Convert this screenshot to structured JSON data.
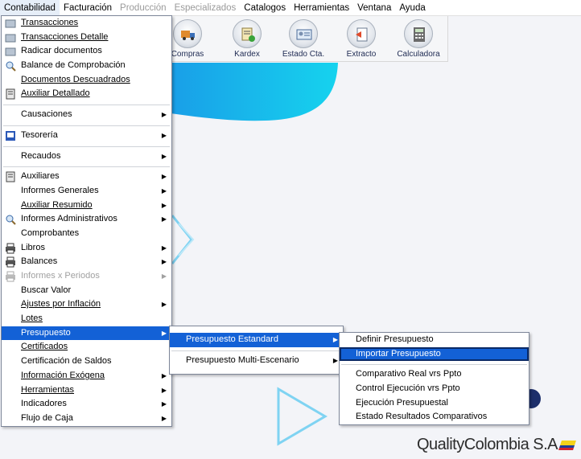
{
  "menubar": {
    "items": [
      {
        "label": "Contabilidad",
        "state": "active"
      },
      {
        "label": "Facturación",
        "state": "normal"
      },
      {
        "label": "Producción",
        "state": "disabled"
      },
      {
        "label": "Especializados",
        "state": "disabled"
      },
      {
        "label": "Catalogos",
        "state": "normal"
      },
      {
        "label": "Herramientas",
        "state": "normal"
      },
      {
        "label": "Ventana",
        "state": "normal"
      },
      {
        "label": "Ayuda",
        "state": "normal"
      }
    ]
  },
  "toolbar": {
    "compras": "Compras",
    "kardex": "Kardex",
    "estado_cta": "Estado Cta.",
    "extracto": "Extracto",
    "calculadora": "Calculadora"
  },
  "contabilidad_menu": {
    "transacciones": "Transacciones",
    "transacciones_detalle": "Transacciones Detalle",
    "radicar_documentos": "Radicar documentos",
    "balance_comprobacion": "Balance de Comprobación",
    "documentos_descuadrados": "Documentos Descuadrados",
    "auxiliar_detallado": "Auxiliar Detallado",
    "causaciones": "Causaciones",
    "tesoreria": "Tesorería",
    "recaudos": "Recaudos",
    "auxiliares": "Auxiliares",
    "informes_generales": "Informes Generales",
    "auxiliar_resumido": "Auxiliar Resumido",
    "informes_administrativos": "Informes Administrativos",
    "comprobantes": "Comprobantes",
    "libros": "Libros",
    "balances": "Balances",
    "informes_x_periodos": "Informes x Periodos",
    "buscar_valor": "Buscar Valor",
    "ajustes_inflacion": "Ajustes por Inflación",
    "lotes": "Lotes",
    "presupuesto": "Presupuesto",
    "certificados": "Certificados",
    "certificacion_saldos": "Certificación de Saldos",
    "informacion_exogena": "Información Exógena",
    "herramientas": "Herramientas",
    "indicadores": "Indicadores",
    "flujo_caja": "Flujo de Caja"
  },
  "presupuesto_menu": {
    "estandar": "Presupuesto  Estandard",
    "multi_escenario": "Presupuesto Multi-Escenario"
  },
  "estandar_menu": {
    "definir": "Definir Presupuesto",
    "importar": "Importar Presupuesto",
    "comparativo": "Comparativo  Real vrs Ppto",
    "control_ejecucion": "Control Ejecución vrs Ppto",
    "ejecucion": "Ejecución Presupuestal",
    "estado_resultados": "Estado Resultados Comparativos"
  },
  "logo": {
    "text": "QualityColombia S.A"
  },
  "colors": {
    "highlight": "#1361d6",
    "accent_cyan": "#16c7ea"
  }
}
